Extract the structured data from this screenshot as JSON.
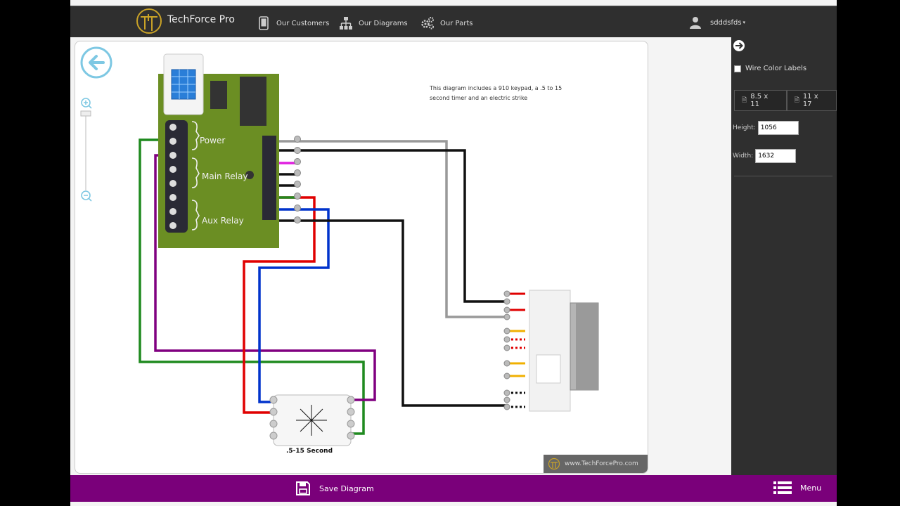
{
  "app": {
    "brand": "TechForce Pro",
    "username": "sdddsfds"
  },
  "nav": {
    "customers": "Our Customers",
    "diagrams": "Our Diagrams",
    "parts": "Our Parts"
  },
  "panel": {
    "wire_color_labels": "Wire Color Labels",
    "size_a": "8.5 x 11",
    "size_b": "11 x 17",
    "height_label": "Height:",
    "height_value": "1056",
    "width_label": "Width:",
    "width_value": "1632"
  },
  "diagram": {
    "description": "This diagram includes a 910 keypad, a .5 to 15 second timer and an electric strike",
    "labels": {
      "power": "Power",
      "main_relay": "Main Relay",
      "aux_relay": "Aux Relay"
    },
    "timer_label": ".5-15 Second",
    "watermark": "www.TechForcePro.com"
  },
  "bottom": {
    "save": "Save Diagram",
    "menu": "Menu"
  },
  "colors": {
    "accent": "#7a007a",
    "board": "#6b8e23",
    "nav_bg": "#2f2f2f"
  }
}
